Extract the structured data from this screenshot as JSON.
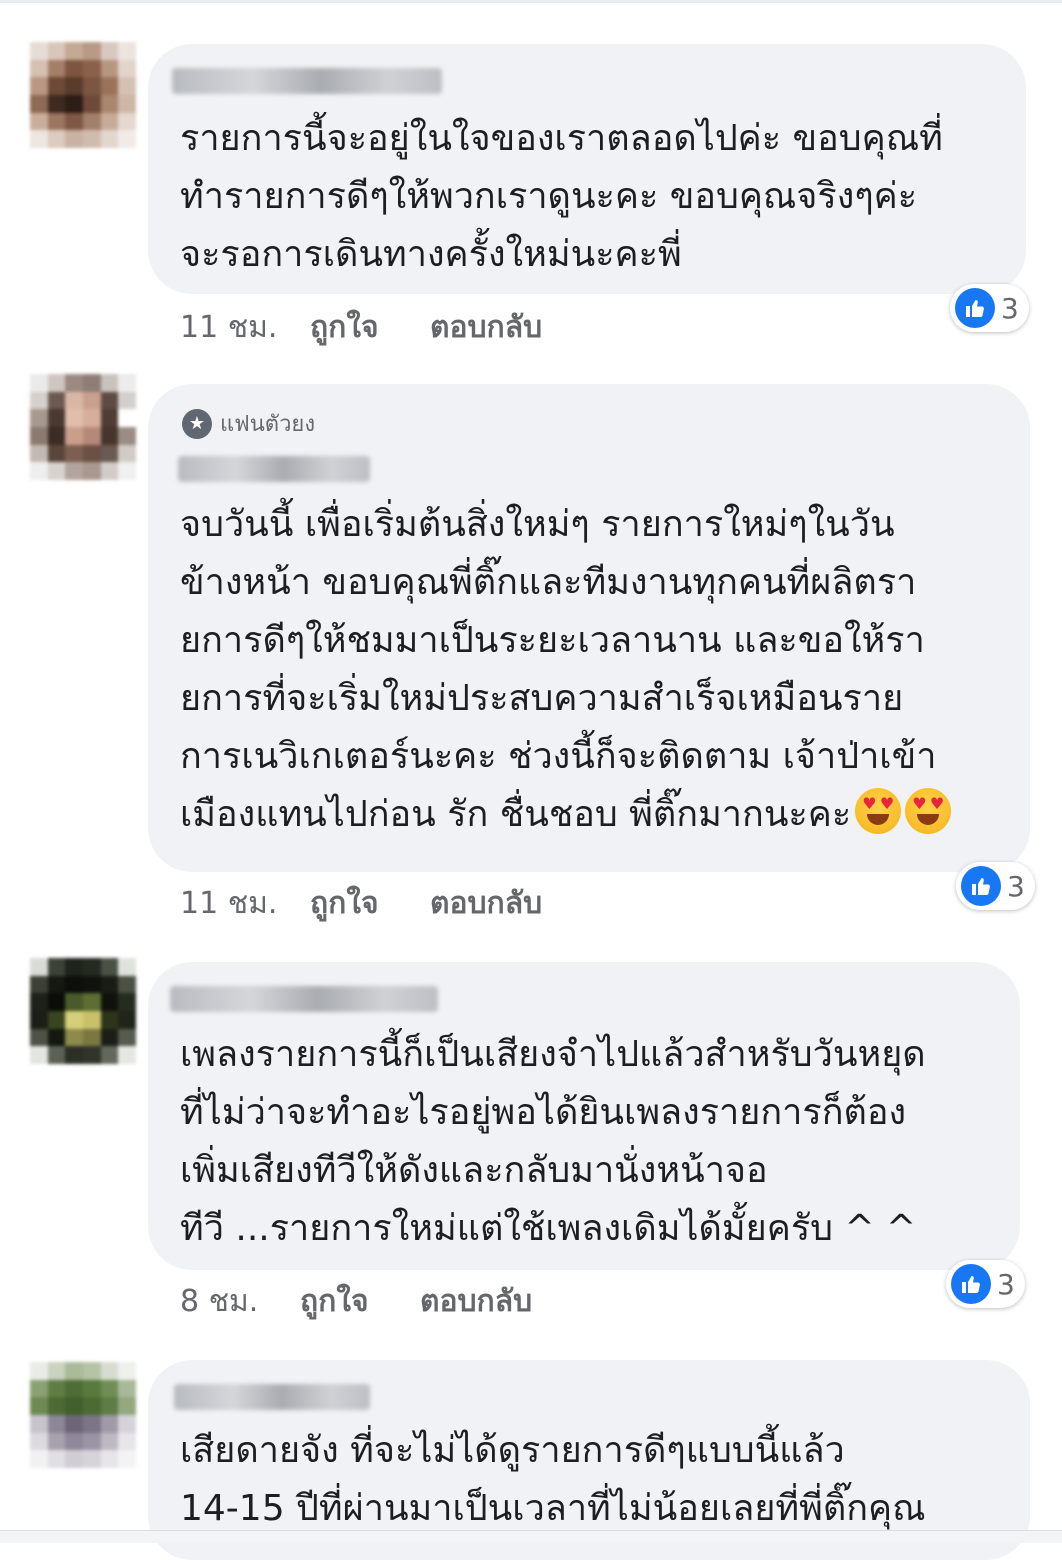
{
  "comments": [
    {
      "badge": "",
      "lines": [
        "รายการนี้จะอยู่ในใจของเราตลอดไปค่ะ ขอบคุณที่",
        "ทำรายการดีๆให้พวกเราดูนะคะ ขอบคุณจริงๆค่ะ",
        "จะรอการเดินทางครั้งใหม่นะคะพี่"
      ],
      "time": "11 ชม.",
      "like_label": "ถูกใจ",
      "reply_label": "ตอบกลับ",
      "reaction_count": "3"
    },
    {
      "badge": "แฟนตัวยง",
      "lines": [
        "จบวันนี้ เพื่อเริ่มต้นสิ่งใหม่ๆ รายการใหม่ๆในวัน",
        "ข้างหน้า ขอบคุณพี่ติ๊กและทีมงานทุกคนที่ผลิตรา",
        "ยการดีๆให้ชมมาเป็นระยะเวลานาน และขอให้รา",
        "ยการที่จะเริ่มใหม่ประสบความสำเร็จเหมือนราย",
        "การเนวิเกเตอร์นะคะ ช่วงนี้ก็จะติดตาม เจ้าป่าเข้า",
        "เมืองแทนไปก่อน รัก ชื่นชอบ พี่ติ๊กมากนะคะ"
      ],
      "time": "11 ชม.",
      "like_label": "ถูกใจ",
      "reply_label": "ตอบกลับ",
      "reaction_count": "3"
    },
    {
      "badge": "",
      "lines": [
        "เพลงรายการนี้ก็เป็นเสียงจำไปแล้วสำหรับวันหยุด",
        "ที่ไม่ว่าจะทำอะไรอยู่พอได้ยินเพลงรายการก็ต้อง",
        "เพิ่มเสียงทีวีให้ดังและกลับมานั่งหน้าจอ",
        "ทีวี ...รายการใหม่แต่ใช้เพลงเดิมได้มั้ยครับ ^  ^"
      ],
      "time": "8 ชม.",
      "like_label": "ถูกใจ",
      "reply_label": "ตอบกลับ",
      "reaction_count": "3"
    },
    {
      "badge": "",
      "lines": [
        "เสียดายจัง ที่จะไม่ได้ดูรายการดีๆแบบนี้แล้ว",
        "14-15 ปีที่ผ่านมาเป็นเวลาที่ไม่น้อยเลยที่พี่ติ๊กคุณ"
      ],
      "time": "",
      "like_label": "",
      "reply_label": "",
      "reaction_count": ""
    }
  ],
  "icons": {
    "reaction": "like-thumb-icon",
    "badge": "star-badge-icon",
    "emoji": "heart-eyes-emoji-icon"
  },
  "colors": {
    "bubble": "#f0f2f5",
    "like_blue": "#1877f2",
    "meta_text": "#65676b"
  }
}
